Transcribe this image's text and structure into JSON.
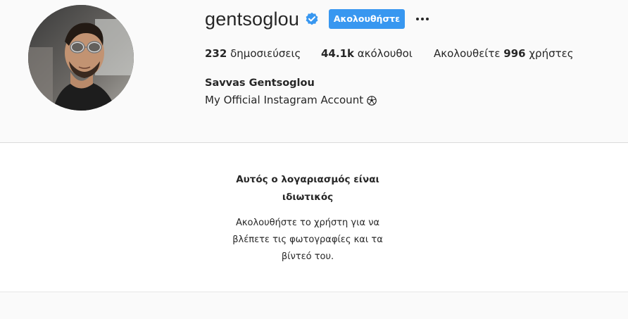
{
  "profile": {
    "username": "gentsoglou",
    "verified_icon": "verified-badge-icon",
    "follow_label": "Ακολουθήστε",
    "more_icon": "more-options-icon",
    "avatar_icon": "profile-avatar",
    "posts_count": "232",
    "posts_label": "δημοσιεύσεις",
    "followers_count": "44.1k",
    "followers_label": "ακόλουθοι",
    "following_prefix": "Ακολουθείτε",
    "following_count": "996",
    "following_suffix": "χρήστες",
    "full_name": "Savvas Gentsoglou",
    "bio": "My Official Instagram Account",
    "bio_emoji_icon": "soccer-ball-icon"
  },
  "private_notice": {
    "title_line1": "Αυτός ο λογαριασμός είναι",
    "title_line2": "ιδιωτικός",
    "text_line1": "Ακολουθήστε το χρήστη για να",
    "text_line2": "βλέπετε τις φωτογραφίες και τα",
    "text_line3": "βίντεό του."
  },
  "colors": {
    "accent": "#3897f0",
    "background": "#fafafa",
    "panel": "#ffffff",
    "text": "#262626"
  }
}
